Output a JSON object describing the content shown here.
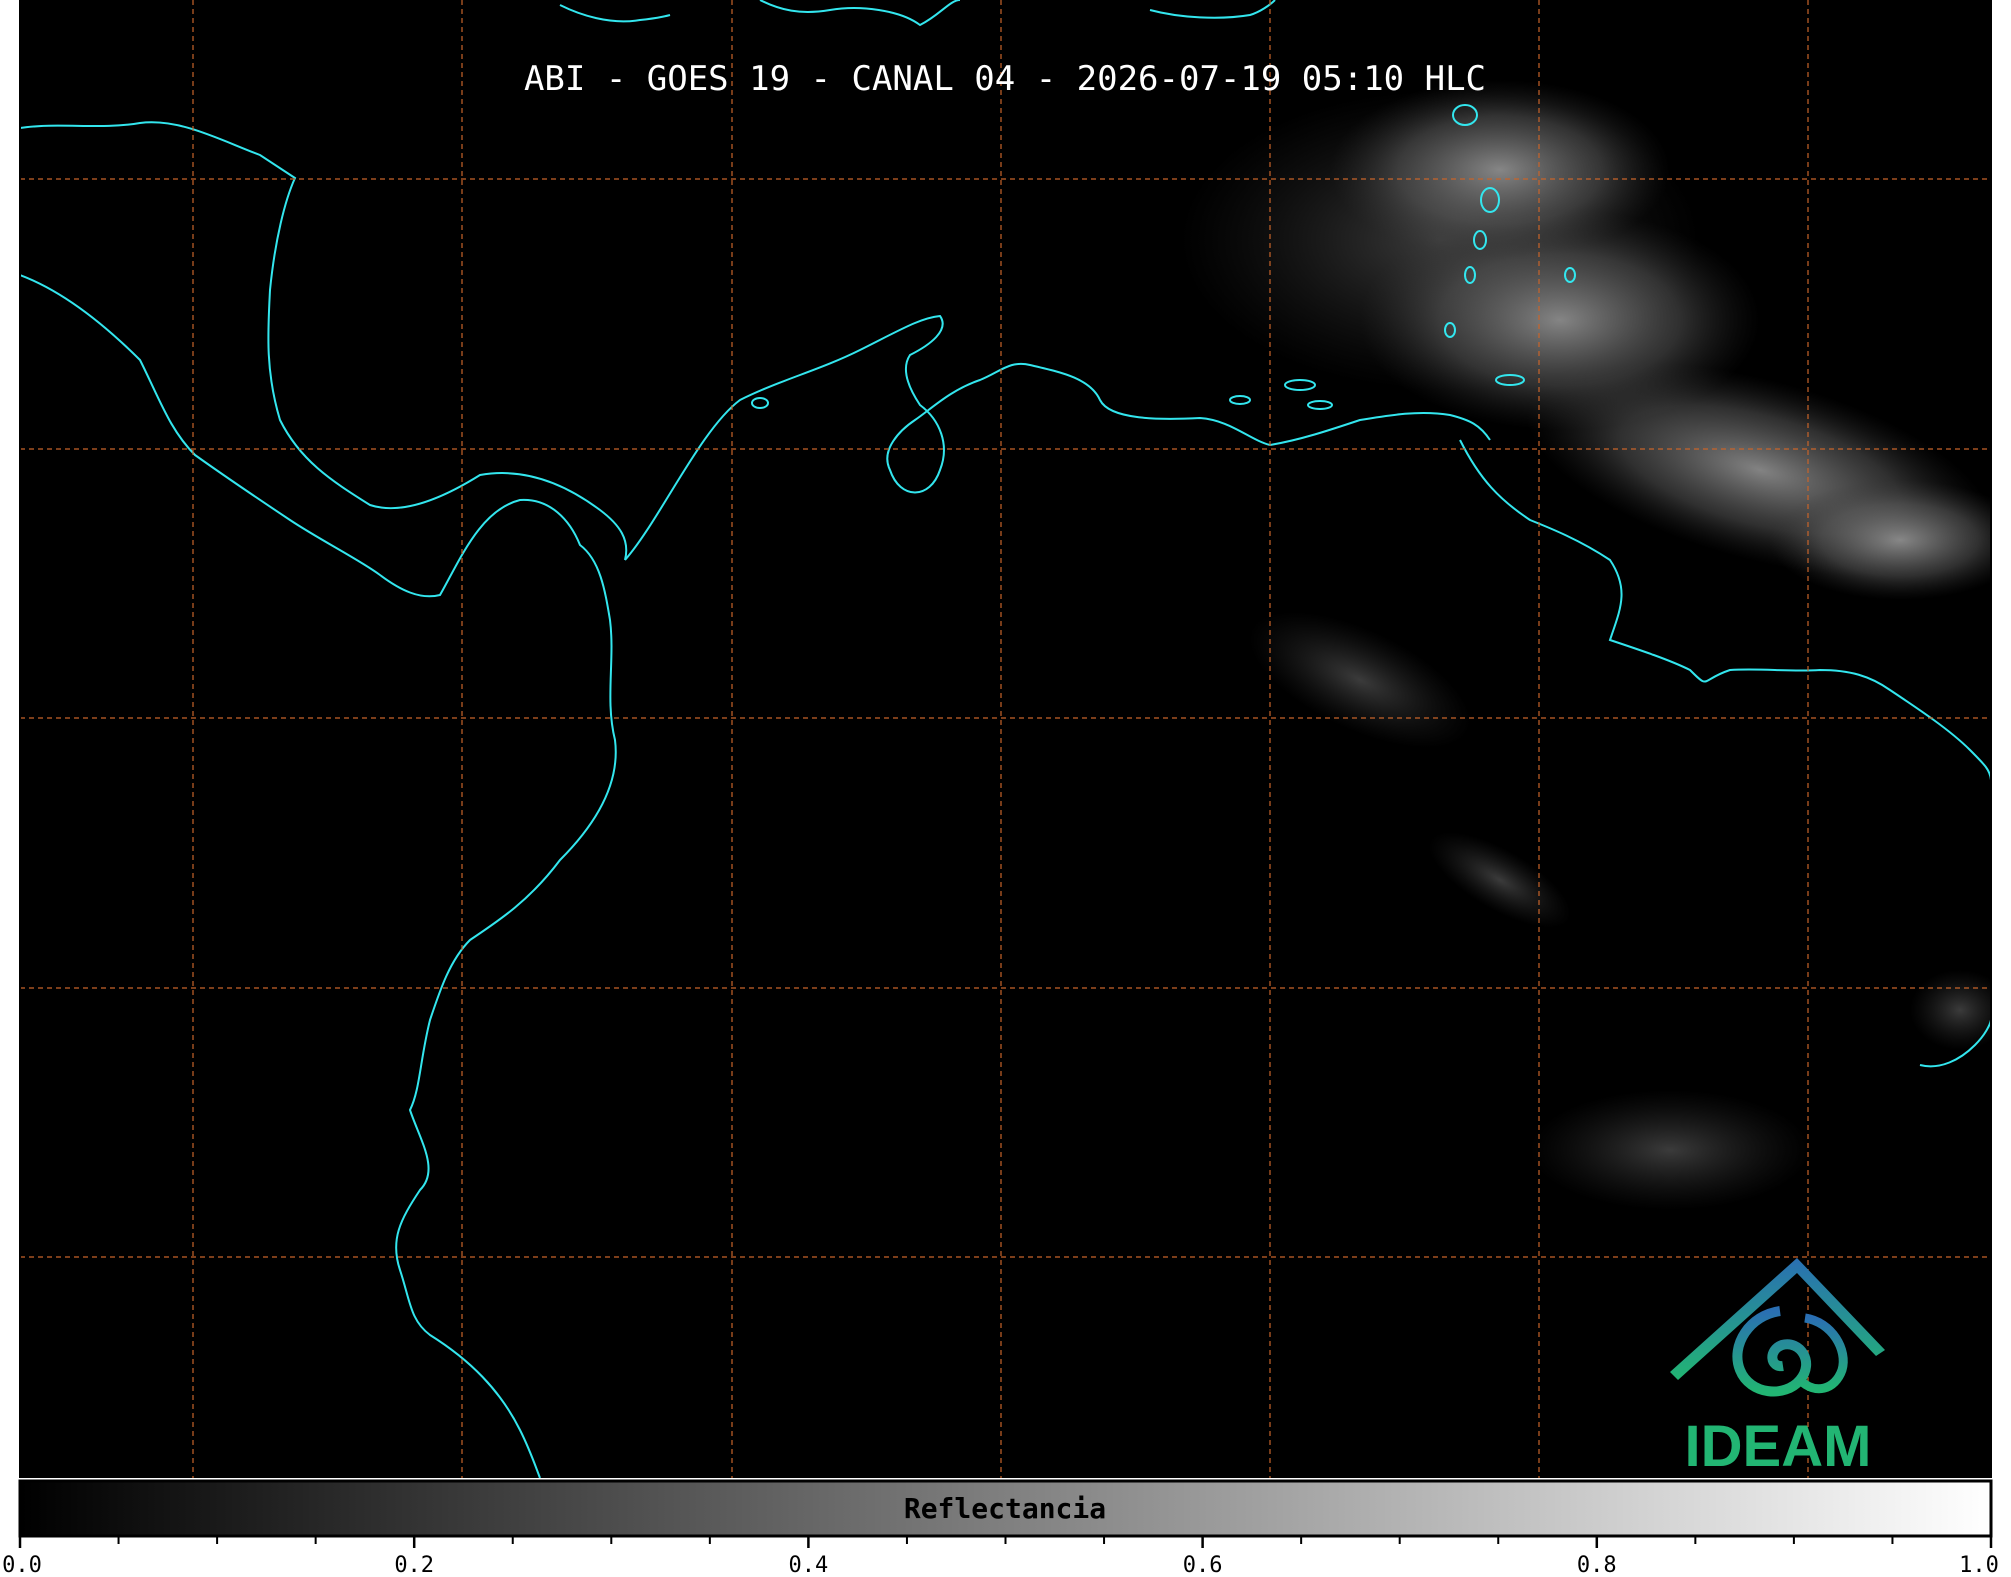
{
  "map": {
    "title": "ABI - GOES 19 - CANAL 04 - 2026-07-19 05:10 HLC",
    "background_color": "#000000",
    "coastline_color": "#33e6ee",
    "grid_color": "#c8642a",
    "grid_style": "dashed"
  },
  "colorbar": {
    "label": "Reflectancia",
    "min": 0.0,
    "max": 1.0,
    "colormap": "grayscale",
    "ticks": [
      "0.0",
      "0.2",
      "0.4",
      "0.6",
      "0.8",
      "1.0"
    ],
    "major_values": [
      0.0,
      0.2,
      0.4,
      0.6,
      0.8,
      1.0
    ],
    "minor_step": 0.05
  },
  "logo": {
    "text": "IDEAM",
    "icon": "ideam-mountain-swirl-icon",
    "color_top": "#2a6fb3",
    "color_bottom": "#22b573"
  }
}
